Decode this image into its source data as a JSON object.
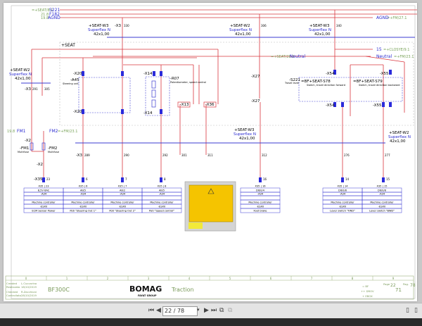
{
  "colors": {
    "wire": "#d9363e",
    "cable": "#3b3bd1",
    "label": "#1a1a1a",
    "xref": "#7aa35a",
    "controller": "#f5c400",
    "title_green": "#7a9a5a"
  },
  "top_refs": {
    "s221": {
      "xref": "=+SEAT/8.1",
      "label": "S221"
    },
    "f182": {
      "xref": "21.8",
      "label": "F182"
    },
    "agnd": {
      "xref": "19.8",
      "label": "AGND"
    },
    "agnd_right": {
      "label": "AGND",
      "xref": "=+FM/27.1"
    },
    "r15": {
      "label": "15",
      "xref": "=+CLOSYE/9.1"
    },
    "neutral_left": {
      "label": "Neutral",
      "xref": "=+SEAT/28.3"
    },
    "neutral_right": {
      "label": "Neutral",
      "xref": "=+FM/23.1"
    },
    "fm1": {
      "xref": "19.8",
      "label": "FM1"
    },
    "fm2": {
      "label": "FM2",
      "xref": "=+FM/23.1"
    }
  },
  "cables": [
    {
      "name": "+SEAT-W3",
      "type": "Superflex N",
      "size": "42x1,00"
    },
    {
      "name": "+SEAT-W2",
      "type": "Superflex N",
      "size": "42x1,00"
    },
    {
      "name": "+SEAT-W3",
      "type": "Superflex N",
      "size": "42x1,00"
    },
    {
      "name": "+SEAT-W2",
      "type": "Superflex N",
      "size": "42x1,00"
    },
    {
      "name": "+SEAT-W3",
      "type": "Superflex N",
      "size": "42x1,00"
    },
    {
      "name": "+SEAT-W2",
      "type": "Superflex N",
      "size": "42x1,00"
    }
  ],
  "seat_label": "+SEAT",
  "components": {
    "x3_330": "-X3",
    "x3_330_pin": "330",
    "x3_306_pin": "306",
    "x3_340_pin": "340",
    "x3_left": "-X3",
    "x3_left_pin1": "291",
    "x3_left_pin2": "305",
    "x20": "-X20",
    "a45": "-A45",
    "a45_desc": "Steering unit",
    "x14": "-X14",
    "r07": "-R07",
    "r07_desc": "Potentiometer, speed control",
    "x13": "-X13",
    "x36": "-X36",
    "x27": "-X27",
    "s221": "-S221",
    "s221_desc": "Travel lever",
    "s78": "=BF+SEAT-S78",
    "s78_desc": "Switch, travel direction forward",
    "s79": "=BF+SEAT-S79",
    "s79_desc": "Switch, travel direction backward",
    "x54": "-X54",
    "x55": "-X55",
    "x2": "-X2",
    "fm1": "-FM1",
    "fm1_desc": "Multifuse",
    "fm2": "-FM2",
    "fm2_desc": "Multifuse",
    "x3_bottom": "-X3",
    "x35": "-X35"
  },
  "bottom_pins": [
    "289",
    "290",
    "292",
    "301",
    "311",
    "312",
    "276",
    "277"
  ],
  "connector_pins": [
    "23",
    "6",
    "7",
    "8",
    "16",
    "14",
    "15"
  ],
  "tables": [
    {
      "cols": [
        {
          "pin": "X35 | 23",
          "sig": "8,5V 6AC",
          "comp": "-A34",
          "ctrl": "Machine controller",
          "unit": "-ESX0",
          "desc": "ECM Sensor Power"
        },
        {
          "pin": "X35 | 6",
          "sig": "AIE5",
          "comp": "-A34",
          "ctrl": "Machine controller",
          "unit": "-ESX0",
          "desc": "Poti \"Steering Out 1\""
        },
        {
          "pin": "X35 | 7",
          "sig": "AIE2",
          "comp": "-A34",
          "ctrl": "Machine controller",
          "unit": "-ESX0",
          "desc": "Poti \"Steering Out 2\""
        },
        {
          "pin": "X35 | 8",
          "sig": "AIE5",
          "comp": "-A34",
          "ctrl": "Machine controller",
          "unit": "-ESX0",
          "desc": "Poti \"Speed control\""
        }
      ]
    },
    {
      "cols": [
        {
          "pin": "X35 | 16",
          "sig": "DIE0/4",
          "comp": "-A34",
          "ctrl": "Machine controller",
          "unit": "-ESX0",
          "desc": "Foot brake"
        }
      ]
    },
    {
      "cols": [
        {
          "pin": "X35 | 14",
          "sig": "DIE0/8",
          "comp": "-A34",
          "ctrl": "Machine controller",
          "unit": "-ESX0",
          "desc": "Lever switch \"FWD\""
        },
        {
          "pin": "X35 | 15",
          "sig": "DIE0/8",
          "comp": "-A34",
          "ctrl": "Machine controller",
          "unit": "-ESX0",
          "desc": "Lever switch \"BWD\""
        }
      ]
    }
  ],
  "title_block": {
    "columns": [
      "0",
      "1",
      "2",
      "3",
      "4",
      "5",
      "6",
      "7",
      "8",
      "9"
    ],
    "created_label": "Created",
    "created_label2": "Realizzato",
    "created_by": "L.Cuccarino",
    "created_date": "18/10/2019",
    "checked_label": "Checked",
    "checked_label2": "Controllato",
    "checked_by": "R.Zacchioni",
    "checked_date": "28/10/2019",
    "machine": "BF300C",
    "brand": "BOMAG",
    "brand_sub": "FAYAT GROUP",
    "title": "Traction",
    "field1": "= BF",
    "field2": "++ DROV",
    "field3": "+ EBOX",
    "page_label": "Page",
    "page": "22",
    "of_label": "Pag.",
    "total": "78",
    "sheet": "71"
  },
  "toolbar": {
    "page_value": "22 / 78",
    "icons": [
      "first-page-icon",
      "prev-page-icon",
      "next-page-icon",
      "last-page-icon",
      "zoom-fit-icon",
      "rotate-icon"
    ]
  }
}
